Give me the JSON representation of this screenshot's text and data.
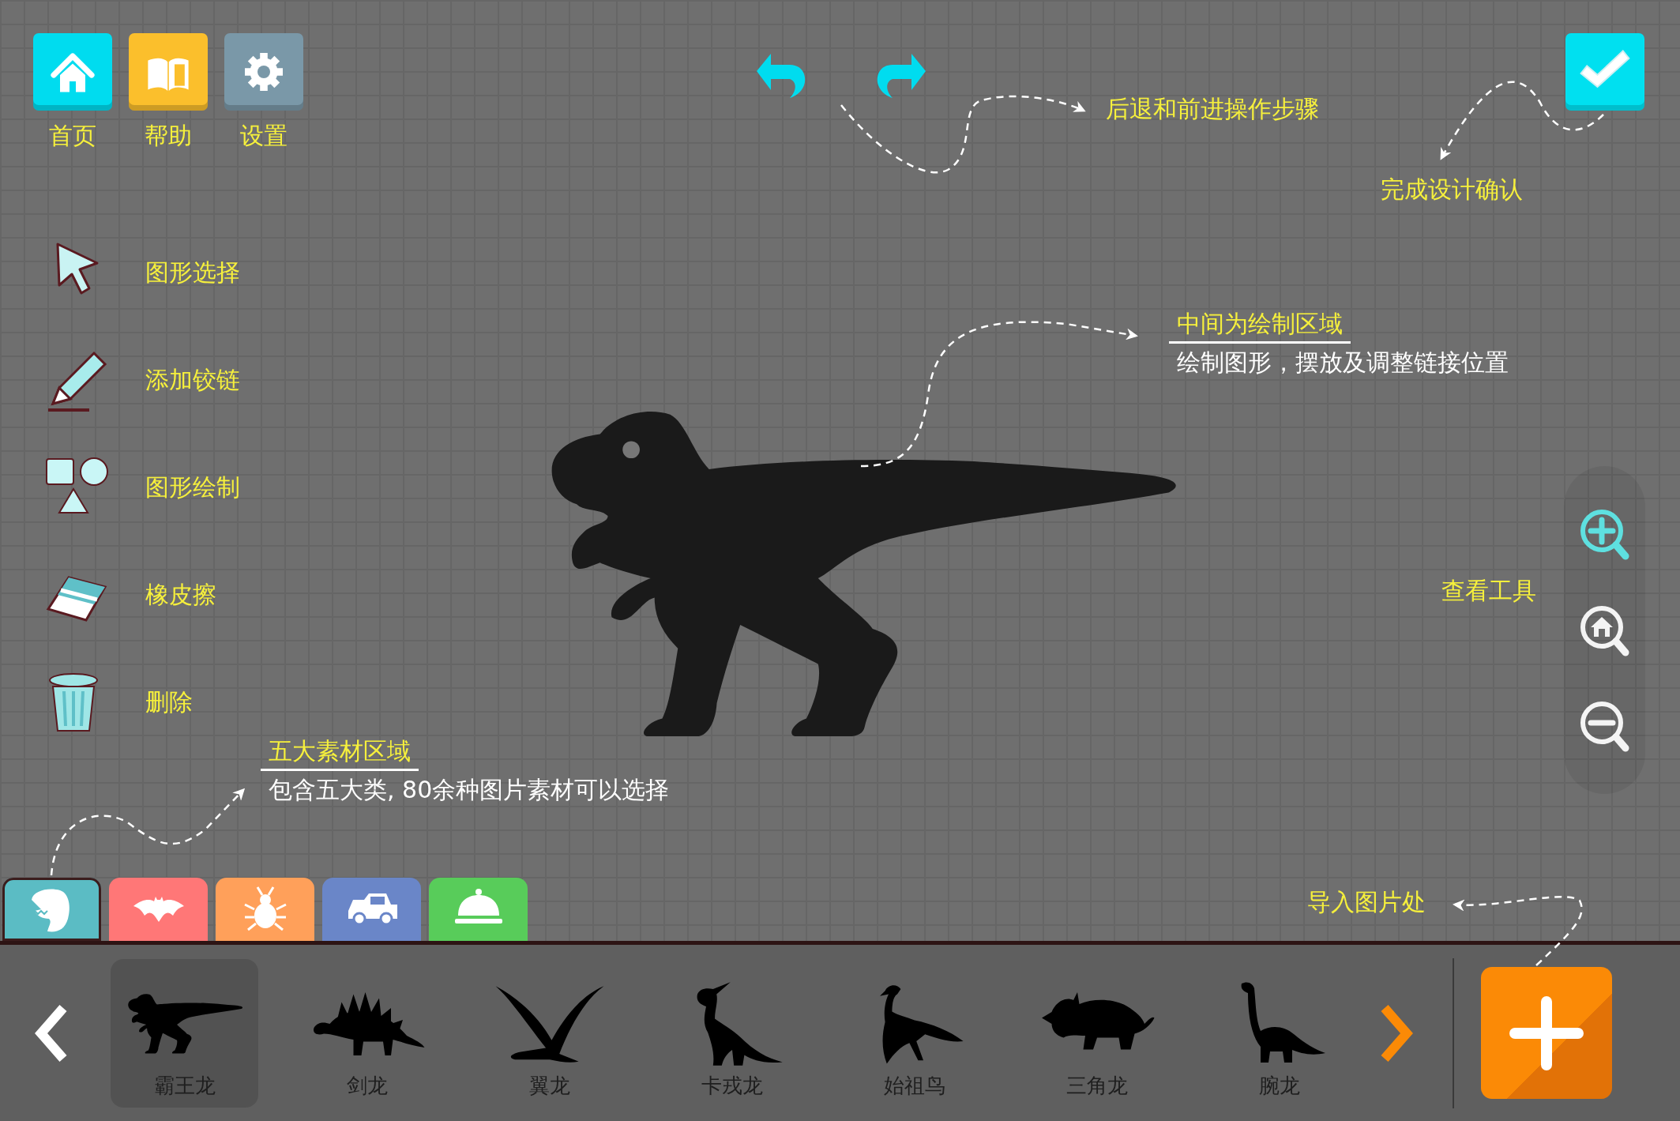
{
  "top_buttons": [
    {
      "kind": "home",
      "label": "首页",
      "color": "#00dcef"
    },
    {
      "kind": "help",
      "label": "帮助",
      "color": "#fbbf2c"
    },
    {
      "kind": "settings",
      "label": "设置",
      "color": "#7a98a8"
    }
  ],
  "history": [
    {
      "kind": "undo"
    },
    {
      "kind": "redo"
    }
  ],
  "tools": [
    {
      "kind": "select",
      "label": "图形选择"
    },
    {
      "kind": "hinge",
      "label": "添加铰链"
    },
    {
      "kind": "shapes",
      "label": "图形绘制"
    },
    {
      "kind": "eraser",
      "label": "橡皮擦"
    },
    {
      "kind": "delete",
      "label": "删除"
    }
  ],
  "annotations": [
    {
      "kind": "history",
      "title": "后退和前进操作步骤"
    },
    {
      "kind": "confirm",
      "title": "完成设计确认"
    },
    {
      "kind": "canvas",
      "title": "中间为绘制区域",
      "subtitle": "绘制图形，摆放及调整链接位置"
    },
    {
      "kind": "view",
      "title": "查看工具"
    },
    {
      "kind": "materials",
      "title": "五大素材区域",
      "subtitle": "包含五大类, 80余种图片素材可以选择"
    },
    {
      "kind": "import",
      "title": "导入图片处"
    }
  ],
  "zoom_tools": [
    {
      "kind": "zoom-in",
      "selected": true
    },
    {
      "kind": "reset",
      "selected": false
    },
    {
      "kind": "zoom-out",
      "selected": false
    }
  ],
  "category_tabs": [
    {
      "kind": "dinosaur",
      "color": "#5bbcc4",
      "selected": true
    },
    {
      "kind": "bat",
      "color": "#ff7777",
      "selected": false
    },
    {
      "kind": "bug",
      "color": "#ffa05a",
      "selected": false
    },
    {
      "kind": "car",
      "color": "#6a86c8",
      "selected": false
    },
    {
      "kind": "cloche",
      "color": "#58cc5a",
      "selected": false
    }
  ],
  "assets": [
    {
      "kind": "trex",
      "label": "霸王龙",
      "selected": true
    },
    {
      "kind": "stegosaurus",
      "label": "剑龙",
      "selected": false
    },
    {
      "kind": "pterosaur",
      "label": "翼龙",
      "selected": false
    },
    {
      "kind": "crested",
      "label": "卡戎龙",
      "selected": false
    },
    {
      "kind": "bird",
      "label": "始祖鸟",
      "selected": false
    },
    {
      "kind": "triceratops",
      "label": "三角龙",
      "selected": false
    },
    {
      "kind": "longneck",
      "label": "腕龙",
      "selected": false
    }
  ]
}
